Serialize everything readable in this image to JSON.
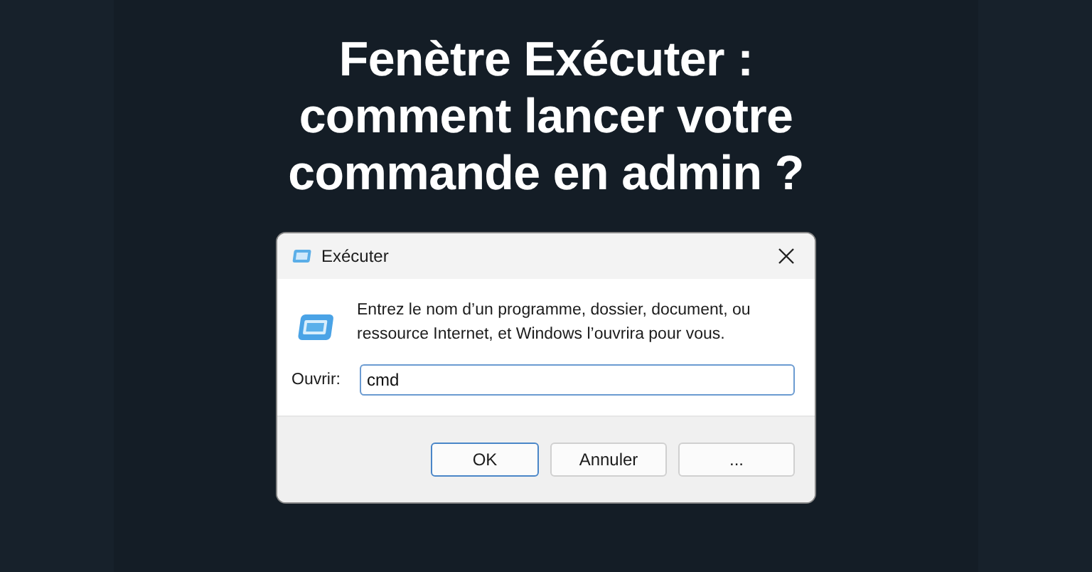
{
  "headline": {
    "lines": [
      "Fenètre Exécuter :",
      "comment lancer votre",
      "commande en admin ?"
    ]
  },
  "dialog": {
    "title": "Exécuter",
    "message": "Entrez le nom d’un programme, dossier, document, ou ressource Internet, et Windows l’ouvrira pour vous.",
    "open_label": "Ouvrir:",
    "open_value": "cmd",
    "buttons": [
      {
        "label": "OK",
        "focused": true
      },
      {
        "label": "Annuler",
        "focused": false
      },
      {
        "label": "...",
        "focused": false
      }
    ]
  }
}
